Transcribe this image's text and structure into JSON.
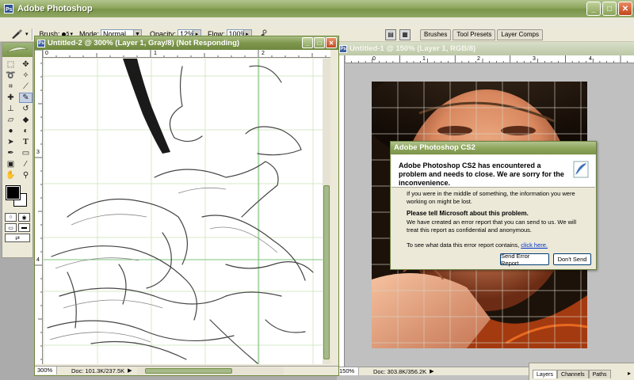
{
  "app": {
    "title": "Adobe Photoshop",
    "window_buttons": {
      "minimize": "_",
      "maximize": "□",
      "close": "✕"
    }
  },
  "options_bar": {
    "brush_label": "Brush:",
    "brush_size": "5",
    "mode_label": "Mode:",
    "mode_value": "Normal",
    "opacity_label": "Opacity:",
    "opacity_value": "12%",
    "flow_label": "Flow:",
    "flow_value": "100%"
  },
  "dock_tabs": [
    "Brushes",
    "Tool Presets",
    "Layer Comps"
  ],
  "doc_active": {
    "title": "Untitled-2 @ 300% (Layer 1, Gray/8) (Not Responding)",
    "ruler_h": [
      "0",
      "1",
      "2"
    ],
    "ruler_v": [
      "3",
      "4"
    ],
    "zoom": "300%",
    "doc_size": "Doc: 101.3K/237.5K"
  },
  "doc_inactive": {
    "title": "Untitled-1 @ 150% (Layer 1, RGB/8)",
    "ruler_h": [
      "0",
      "1",
      "2",
      "3",
      "4"
    ],
    "zoom": "150%",
    "doc_size": "Doc: 303.8K/356.2K"
  },
  "dialog": {
    "title": "Adobe Photoshop CS2",
    "heading": "Adobe Photoshop CS2 has encountered a problem and needs to close.  We are sorry for the inconvenience.",
    "para1": "If you were in the middle of something, the information you were working on might be lost.",
    "tell_heading": "Please tell Microsoft about this problem.",
    "para2": "We have created an error report that you can send to us.  We will treat this report as confidential and anonymous.",
    "report_prefix": "To see what data this error report contains, ",
    "report_link": "click here.",
    "send_button": "Send Error Report",
    "dont_send_button": "Don't Send"
  },
  "layers_panel": {
    "tabs": [
      "Layers",
      "Channels",
      "Paths"
    ]
  },
  "colors": {
    "titlebar": "#8ea65d",
    "dialog_bg": "#ece9d8",
    "link": "#0033cc"
  }
}
